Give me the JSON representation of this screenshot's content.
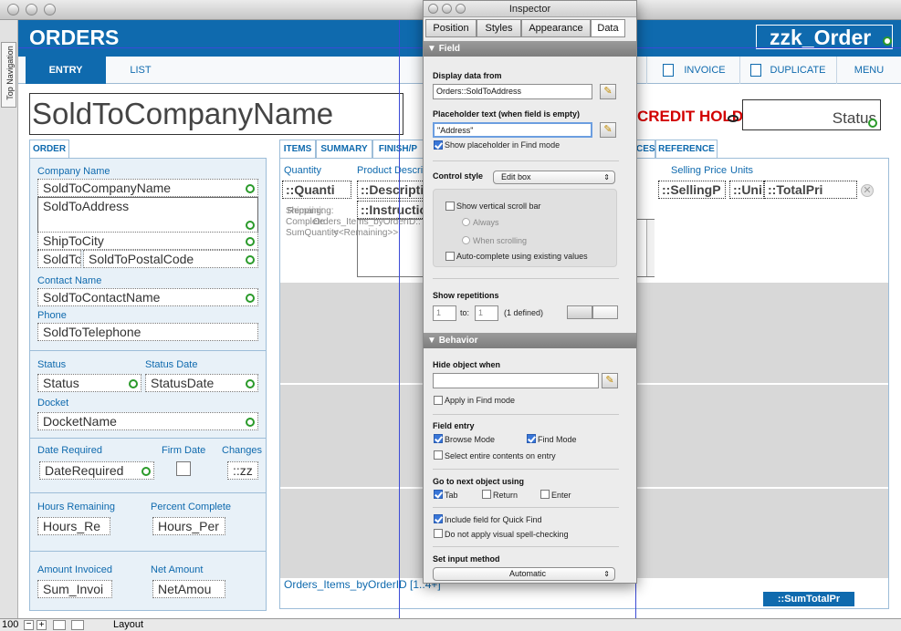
{
  "window": {
    "sidebar_tab": "Top Navigation"
  },
  "header": {
    "title": "ORDERS",
    "right_field": "zzk_Order"
  },
  "nav": {
    "entry": "ENTRY",
    "list": "LIST",
    "invoice": "INVOICE",
    "duplicate": "DUPLICATE",
    "menu": "MENU"
  },
  "top": {
    "company_title": "SoldToCompanyName",
    "credit_hold": "CREDIT HOLD",
    "status": "Status"
  },
  "order_tab": "ORDER",
  "order_panel": {
    "company_label": "Company Name",
    "company": "SoldToCompanyName",
    "address": "SoldToAddress",
    "city": "ShipToCity",
    "state": "SoldTo",
    "postal": "SoldToPostalCode",
    "contact_label": "Contact Name",
    "contact": "SoldToContactName",
    "phone_label": "Phone",
    "phone": "SoldToTelephone",
    "status_label": "Status",
    "status": "Status",
    "status_date_label": "Status Date",
    "status_date": "StatusDate",
    "docket_label": "Docket",
    "docket": "DocketName",
    "date_required_label": "Date Required",
    "date_required": "DateRequired",
    "firm_date_label": "Firm Date",
    "changes_label": "Changes",
    "changes": "::zz",
    "hours_label": "Hours Remaining",
    "hours": "Hours_Re",
    "percent_label": "Percent Complete",
    "percent": "Hours_Per",
    "amount_inv_label": "Amount Invoiced",
    "amount_inv": "Sum_Invoi",
    "net_label": "Net Amount",
    "net": "NetAmou"
  },
  "item_tabs": [
    "ITEMS",
    "SUMMARY",
    "FINISH/P",
    "CES",
    "REFERENCE"
  ],
  "items": {
    "col_quantity": "Quantity",
    "col_product": "Product Descrip",
    "col_selling": "Selling Price",
    "col_units": "Units",
    "cell_qty": "::Quanti",
    "cell_desc": "::Descripti",
    "cell_instr": "::Instruction",
    "cell_selling": "::SellingP",
    "cell_units": "::Uni",
    "cell_total": "::TotalPri",
    "overlap_text1": "Shipping:",
    "overlap_text2": "Complete",
    "overlap_text3": "SumQuantity",
    "overlap_text4": "Remaining:",
    "overlap_text5": "Orders_Items_byOrderID::",
    "overlap_text6": "<<Remaining>>",
    "portal_label": "Orders_Items_byOrderID [1..4+]",
    "sum_total": "::SumTotalPr"
  },
  "inspector": {
    "title": "Inspector",
    "tabs": [
      "Position",
      "Styles",
      "Appearance",
      "Data"
    ],
    "field_section": "Field",
    "display_label": "Display data from",
    "display_value": "Orders::SoldToAddress",
    "placeholder_label": "Placeholder text (when field is empty)",
    "placeholder_value": "\"Address\"",
    "show_placeholder": "Show placeholder in Find mode",
    "control_style_label": "Control style",
    "control_style_value": "Edit box",
    "vscroll": "Show vertical scroll bar",
    "always": "Always",
    "when_scrolling": "When scrolling",
    "autocomplete": "Auto-complete using existing values",
    "show_rep_label": "Show repetitions",
    "rep_from": "1",
    "rep_to_label": "to:",
    "rep_to": "1",
    "rep_defined": "(1 defined)",
    "behavior_section": "Behavior",
    "hide_label": "Hide object when",
    "apply_find": "Apply in Find mode",
    "field_entry_label": "Field entry",
    "browse_mode": "Browse Mode",
    "find_mode": "Find Mode",
    "select_entire": "Select entire contents on entry",
    "go_next_label": "Go to next object using",
    "tab": "Tab",
    "return": "Return",
    "enter": "Enter",
    "quick_find": "Include field for Quick Find",
    "spell": "Do not apply visual spell-checking",
    "input_method_label": "Set input method",
    "input_method_value": "Automatic"
  },
  "statusbar": {
    "zoom": "100",
    "mode": "Layout"
  }
}
